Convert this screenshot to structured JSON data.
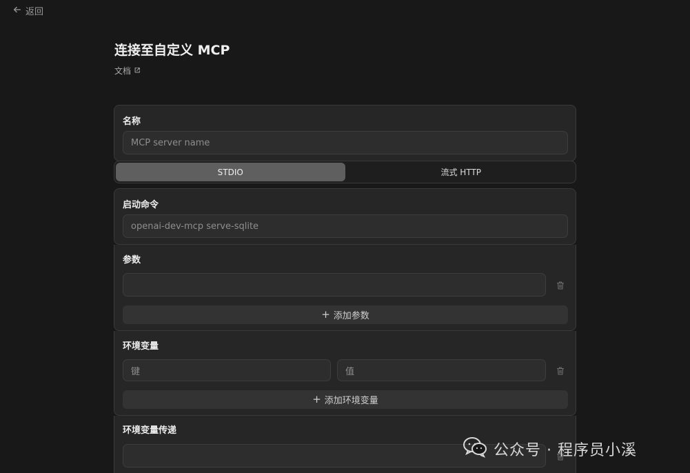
{
  "nav": {
    "back_label": "返回"
  },
  "header": {
    "title": "连接至自定义 MCP",
    "doc_label": "文档"
  },
  "name_section": {
    "label": "名称",
    "placeholder": "MCP server name"
  },
  "transport_tabs": [
    {
      "label": "STDIO",
      "active": true
    },
    {
      "label": "流式 HTTP",
      "active": false
    }
  ],
  "command_section": {
    "label": "启动命令",
    "placeholder": "openai-dev-mcp serve-sqlite"
  },
  "args_section": {
    "label": "参数",
    "input_value": "",
    "add_label": "添加参数"
  },
  "env_section": {
    "label": "环境变量",
    "key_placeholder": "键",
    "value_placeholder": "值",
    "add_label": "添加环境变量"
  },
  "passthrough_section": {
    "label": "环境变量传递",
    "input_value": ""
  },
  "watermark": {
    "text": "公众号 · 程序员小溪"
  },
  "colors": {
    "background": "#181818",
    "card": "#262626",
    "tab_active": "#5f5f5f"
  },
  "icons": [
    "arrow-left-icon",
    "external-link-icon",
    "plus-icon",
    "trash-icon",
    "wechat-icon"
  ]
}
